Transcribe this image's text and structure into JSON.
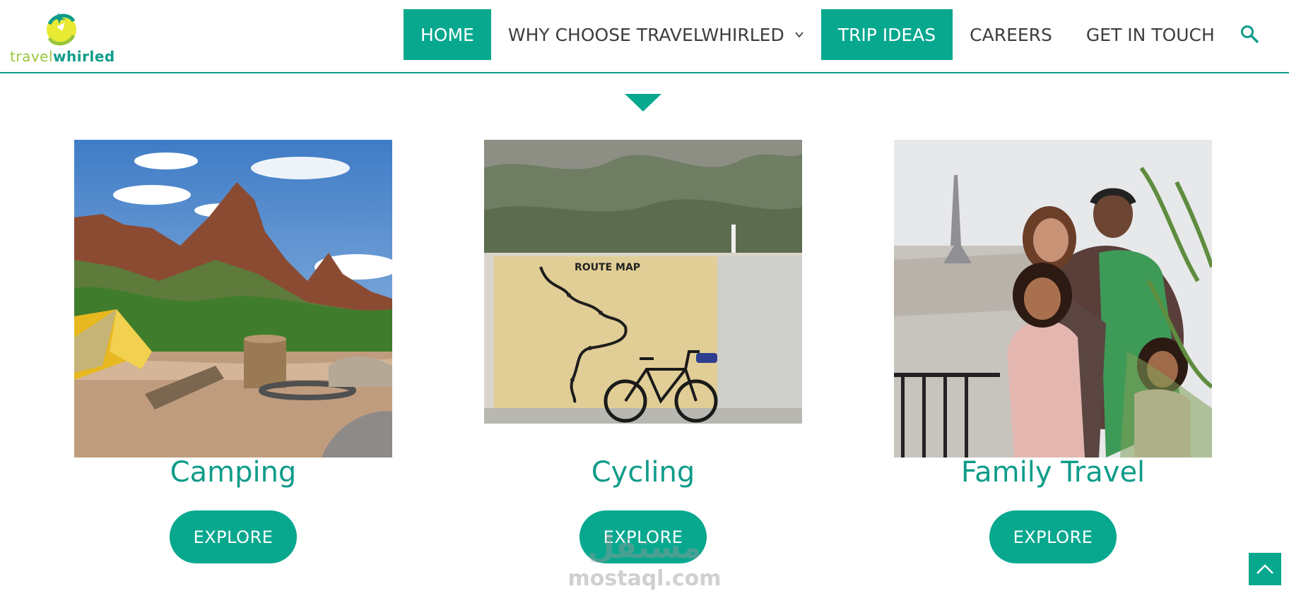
{
  "brand": {
    "logo_text_part1": "travel",
    "logo_text_part2": "whirled"
  },
  "nav": {
    "items": [
      {
        "label": "HOME",
        "active": true
      },
      {
        "label": "WHY CHOOSE TRAVELWHIRLED",
        "active": false,
        "has_dropdown": true
      },
      {
        "label": "TRIP IDEAS",
        "active": true
      },
      {
        "label": "CAREERS",
        "active": false
      },
      {
        "label": "GET IN TOUCH",
        "active": false
      }
    ],
    "search_icon": "search-icon"
  },
  "cards": [
    {
      "title": "Camping",
      "button": "EXPLORE",
      "image": "campsite-tent-red-rock-mountain-photo"
    },
    {
      "title": "Cycling",
      "button": "EXPLORE",
      "image": "bicycle-route-map-wall-mountains-photo"
    },
    {
      "title": "Family Travel",
      "button": "EXPLORE",
      "image": "family-eiffel-tower-balcony-photo"
    }
  ],
  "watermark": {
    "arabic": "مستقل",
    "latin": "mostaql.com"
  },
  "colors": {
    "accent": "#08a88f",
    "accent_text": "#0f9c89",
    "logo_green": "#9bc53d"
  }
}
